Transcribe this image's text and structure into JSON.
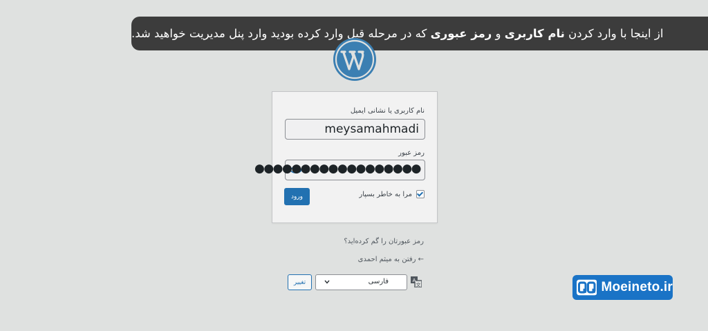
{
  "banner": {
    "part1": "از اینجا با وارد کردن ",
    "bold1": "نام کاربری",
    "part2": " و ",
    "bold2": "رمز عبوری",
    "part3": " که در مرحله قبل وارد کرده بودید وارد پنل مدیریت خواهید شد."
  },
  "login": {
    "username_label": "نام کاربری یا نشانی ایمیل",
    "username_value": "meysamahmadi",
    "password_label": "رمز عبور",
    "password_dots": "●●●●●●●●●●●●●●●●●●",
    "remember_label": "مرا به خاطر بسپار",
    "remember_checked": true,
    "submit_label": "ورود"
  },
  "links": {
    "lost_password": "رمز عبورتان را گم کرده‌اید؟",
    "back_to_site": "← رفتن به میثم احمدی"
  },
  "language": {
    "selected": "فارسی",
    "change_label": "تغییر"
  },
  "brand": {
    "name": "Moeineto.ir"
  },
  "colors": {
    "background": "#dfe1e0",
    "banner": "#3c3c3c",
    "primary": "#2271b1",
    "brand": "#1a73c6"
  },
  "icons": [
    "wordpress-logo-icon",
    "eye-icon",
    "checkbox-check-icon",
    "translate-icon",
    "chevron-down-icon",
    "brand-logo-icon"
  ]
}
